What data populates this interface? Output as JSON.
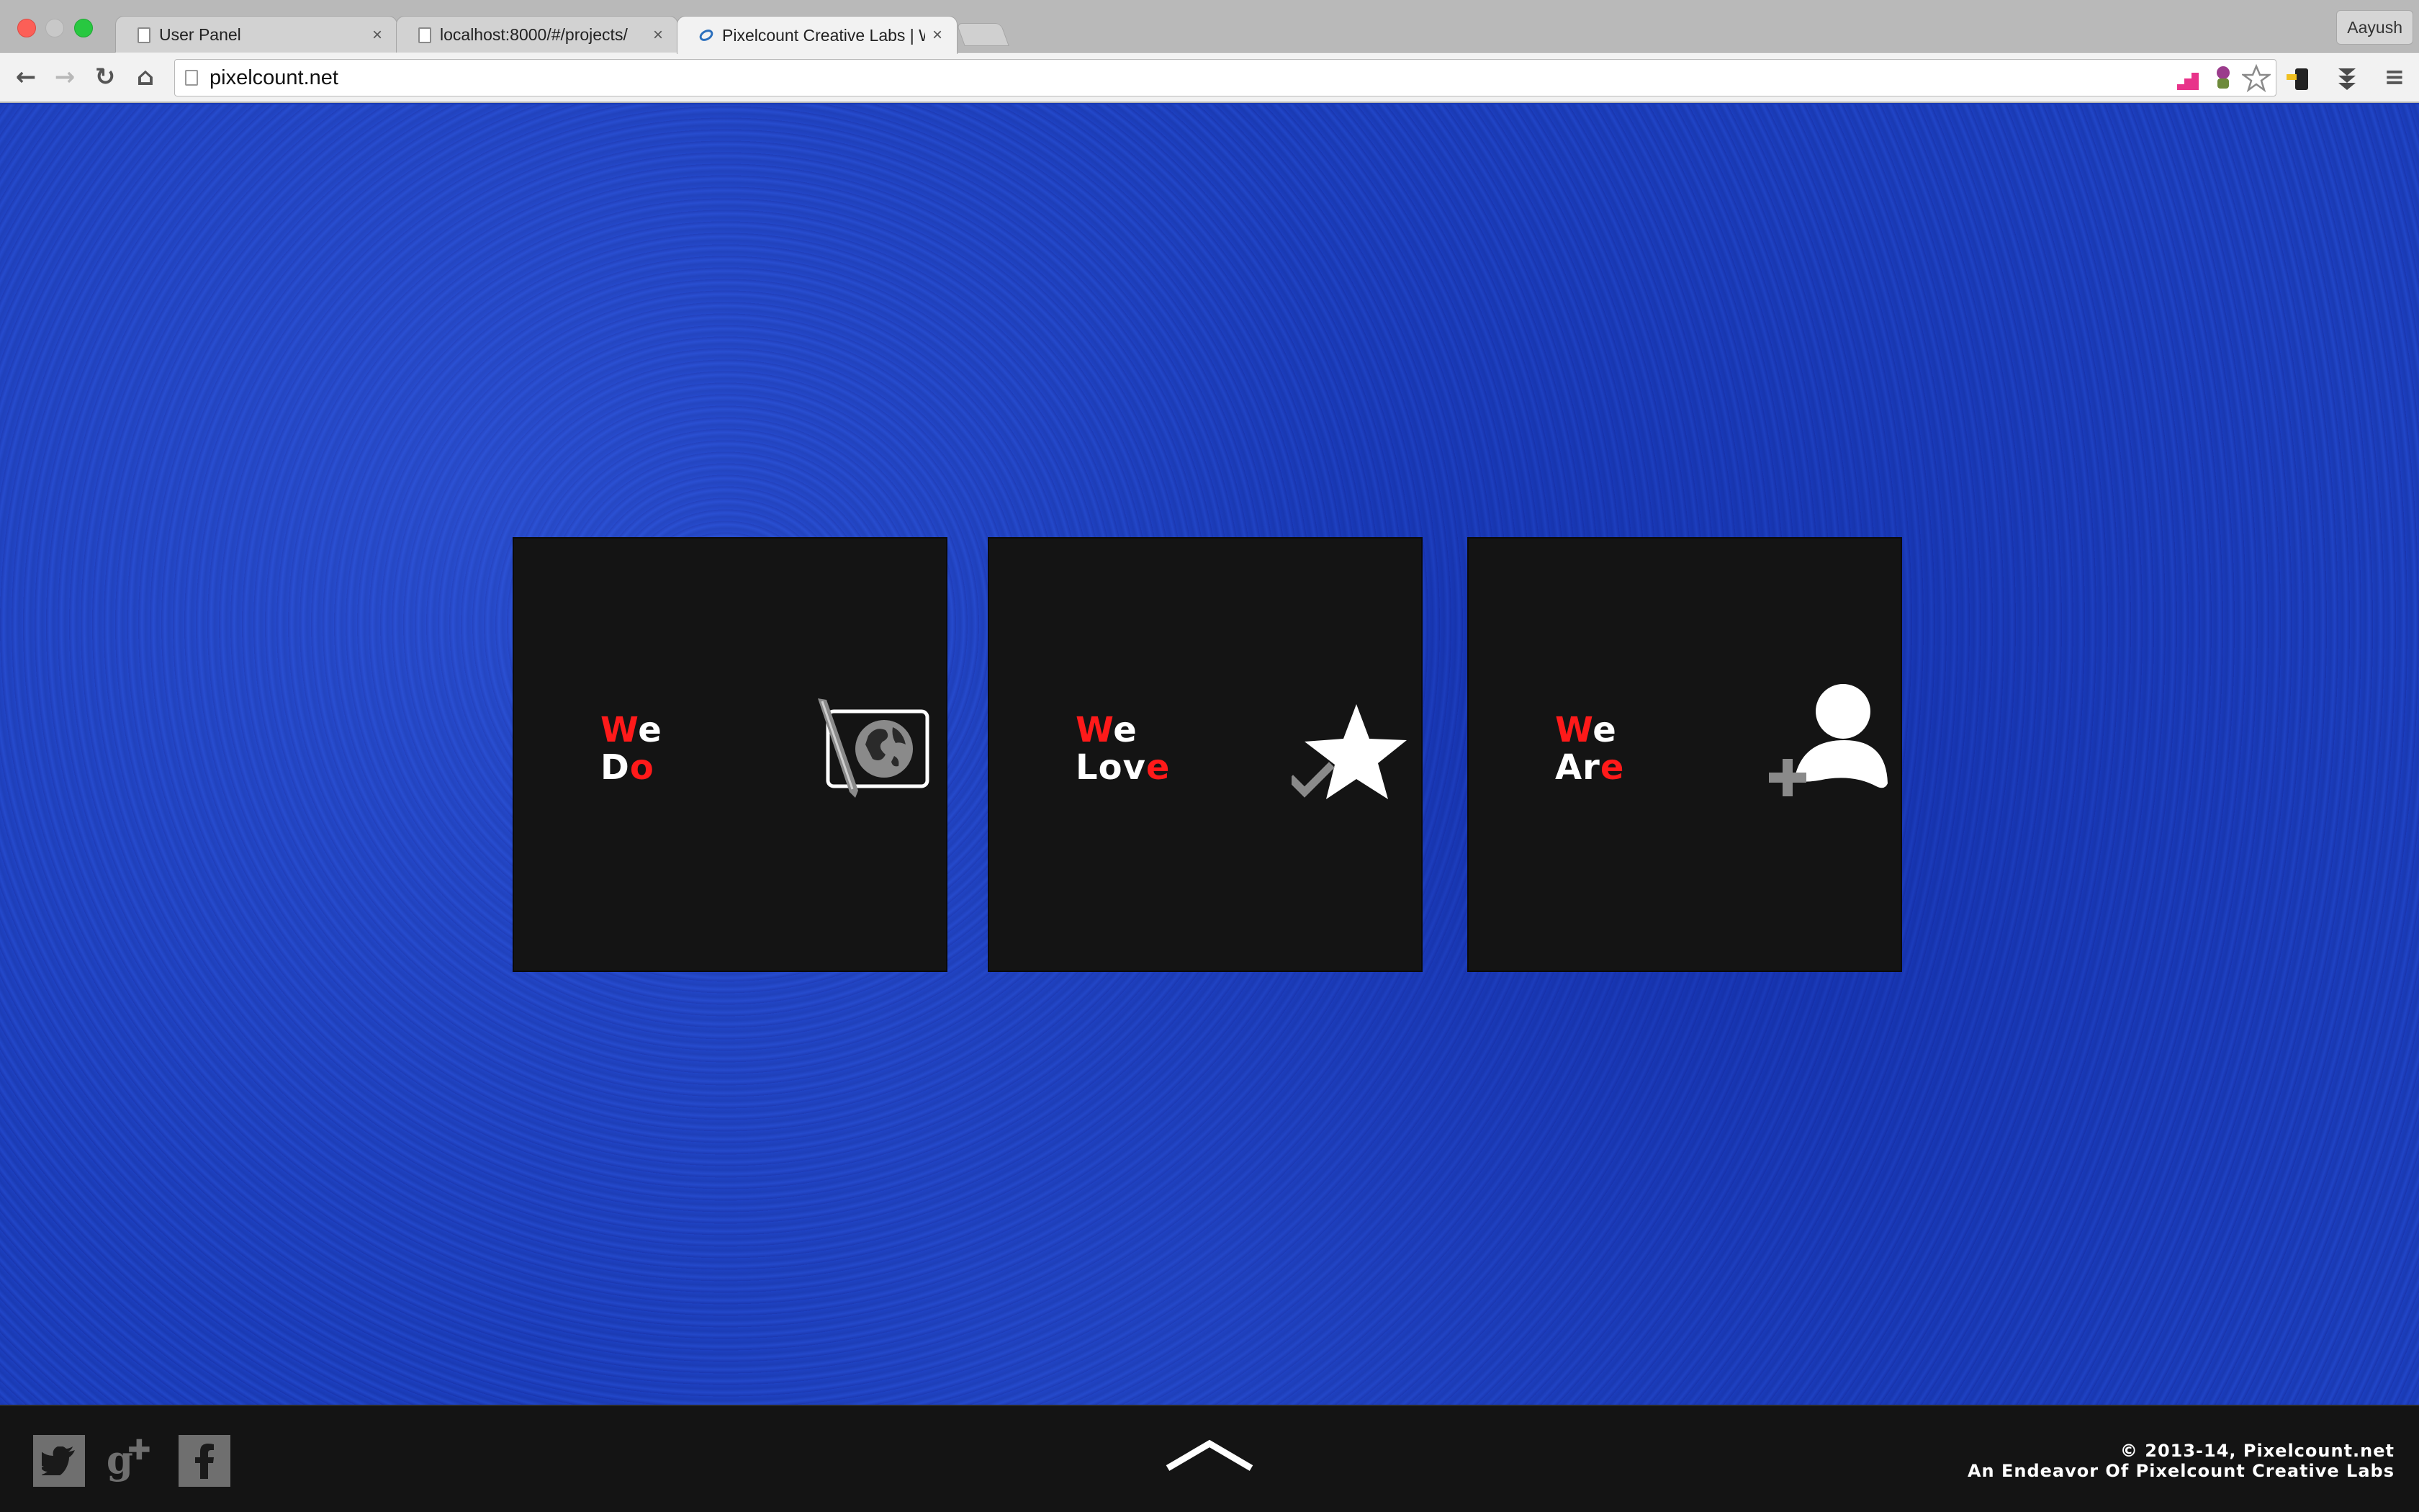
{
  "browser": {
    "tabs": [
      {
        "title": "User Panel",
        "close": "×"
      },
      {
        "title": "localhost:8000/#/projects/",
        "close": "×"
      },
      {
        "title": "Pixelcount Creative Labs | W",
        "close": "×"
      }
    ],
    "profile_name": "Aayush",
    "url": "pixelcount.net",
    "nav": {
      "back": "←",
      "forward": "→",
      "reload": "↻",
      "home": "⌂",
      "menu": "≡"
    }
  },
  "cards": [
    {
      "word1": {
        "red": "W",
        "white": "e"
      },
      "word2": {
        "white": "D",
        "red": "o"
      },
      "icon": "globe-canvas-icon"
    },
    {
      "word1": {
        "red": "W",
        "white": "e"
      },
      "word2": {
        "white": "Lov",
        "red": "e"
      },
      "icon": "star-check-icon"
    },
    {
      "word1": {
        "red": "W",
        "white": "e"
      },
      "word2": {
        "white": "Ar",
        "red": "e"
      },
      "icon": "add-user-icon"
    }
  ],
  "footer": {
    "social": [
      {
        "name": "twitter-icon",
        "glyph": "t"
      },
      {
        "name": "google-plus-icon",
        "glyph": "g+"
      },
      {
        "name": "facebook-icon",
        "glyph": "f"
      }
    ],
    "copyright_line1": "© 2013-14, Pixelcount.net",
    "copyright_line2": "An Endeavor Of Pixelcount Creative Labs"
  },
  "colors": {
    "accent_red": "#ff1a1a",
    "background_blue": "#1a3bb5",
    "card_bg": "#141414"
  }
}
